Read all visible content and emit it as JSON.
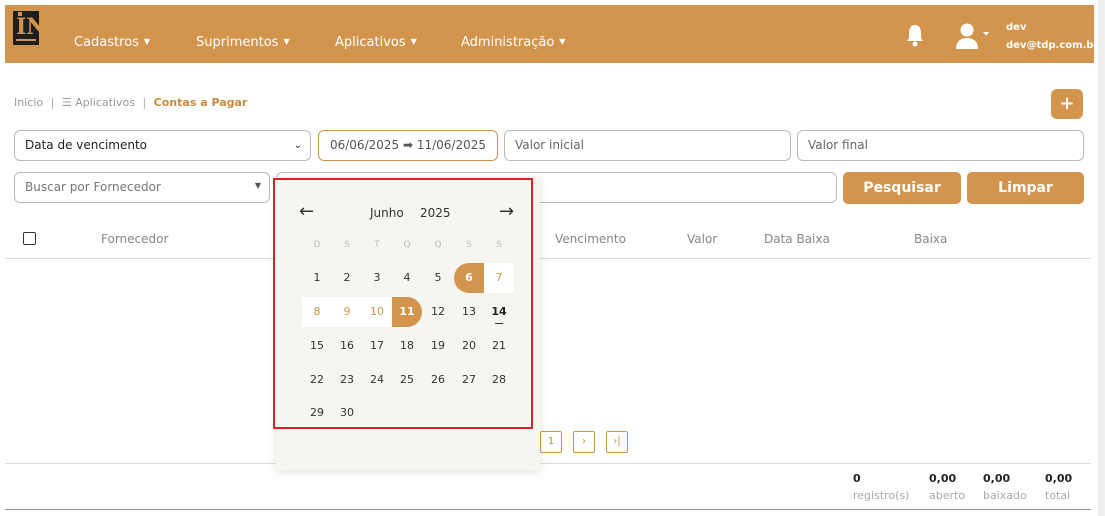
{
  "nav": {
    "logo_text": "IN",
    "items": [
      {
        "label": "Cadastros"
      },
      {
        "label": "Suprimentos"
      },
      {
        "label": "Aplicativos"
      },
      {
        "label": "Administração"
      }
    ],
    "user": {
      "name": "dev",
      "email": "dev@tdp.com.br"
    }
  },
  "breadcrumb": {
    "home": "Inicio",
    "apps": "Aplicativos",
    "current": "Contas a Pagar"
  },
  "add_button_label": "+",
  "filters": {
    "date_type": "Data de vencimento",
    "date_range": "06/06/2025 ➡ 11/06/2025",
    "valor_inicial_placeholder": "Valor inicial",
    "valor_final_placeholder": "Valor final",
    "fornecedor_placeholder": "Buscar por Fornecedor",
    "search_label": "Pesquisar",
    "clear_label": "Limpar"
  },
  "table": {
    "columns": [
      "Fornecedor",
      "Vencimento",
      "Valor",
      "Data Baixa",
      "Baixa"
    ]
  },
  "pagination": {
    "page": "1",
    "next": "›",
    "last": "›|"
  },
  "totals": [
    {
      "value": "0",
      "label": "registro(s)"
    },
    {
      "value": "0,00",
      "label": "aberto"
    },
    {
      "value": "0,00",
      "label": "baixado"
    },
    {
      "value": "0,00",
      "label": "total"
    }
  ],
  "datepicker": {
    "month": "Junho",
    "year": "2025",
    "prev": "←",
    "next": "→",
    "weekdays": [
      "D",
      "S",
      "T",
      "Q",
      "Q",
      "S",
      "S"
    ],
    "range_start": 6,
    "range_end": 11,
    "today": 14,
    "days": [
      "1",
      "2",
      "3",
      "4",
      "5",
      "6",
      "7",
      "8",
      "9",
      "10",
      "11",
      "12",
      "13",
      "14",
      "15",
      "16",
      "17",
      "18",
      "19",
      "20",
      "21",
      "22",
      "23",
      "24",
      "25",
      "26",
      "27",
      "28",
      "29",
      "30"
    ]
  },
  "colors": {
    "accent": "#d3954d",
    "highlight_border": "#d6202a"
  }
}
